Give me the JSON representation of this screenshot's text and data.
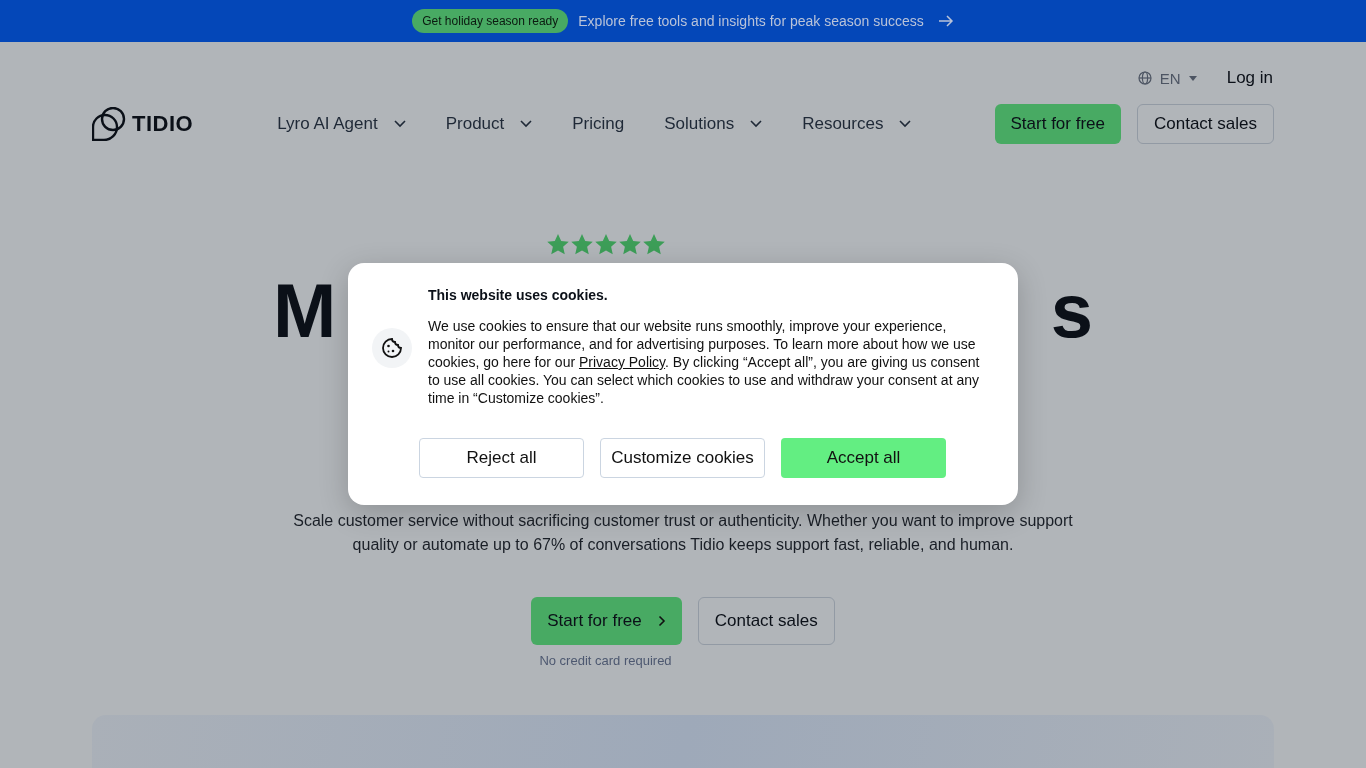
{
  "banner": {
    "badge": "Get holiday season ready",
    "text": "Explore free tools and insights for peak season success"
  },
  "topbar": {
    "language": "EN",
    "login": "Log in"
  },
  "nav": {
    "logo": "TIDIO",
    "items": [
      {
        "label": "Lyro AI Agent",
        "dropdown": true
      },
      {
        "label": "Product",
        "dropdown": true
      },
      {
        "label": "Pricing",
        "dropdown": false
      },
      {
        "label": "Solutions",
        "dropdown": true
      },
      {
        "label": "Resources",
        "dropdown": true
      }
    ],
    "primary": "Start for free",
    "secondary": "Contact sales"
  },
  "hero": {
    "stars": 5,
    "heading_fragments": [
      "M",
      "s"
    ],
    "description": "Scale customer service without sacrificing customer trust or authenticity. Whether you want to improve support quality or automate up to 67% of conversations Tidio keeps support fast, reliable, and human.",
    "primary": "Start for free",
    "secondary": "Contact sales",
    "note": "No credit card required"
  },
  "cookie_dialog": {
    "title": "This website uses cookies.",
    "body_before": "We use cookies to ensure that our website runs smoothly, improve your experience, monitor our performance, and for advertising purposes. To learn more about how we use cookies, go here for our ",
    "link": "Privacy Policy",
    "body_after": ". By clicking “Accept all”, you are giving us consent to use all cookies. You can select which cookies to use and withdraw your consent at any time in “Customize cookies”.",
    "buttons": [
      {
        "label": "Reject all",
        "kind": "outline"
      },
      {
        "label": "Customize cookies",
        "kind": "outline"
      },
      {
        "label": "Accept all",
        "kind": "primary"
      }
    ]
  }
}
